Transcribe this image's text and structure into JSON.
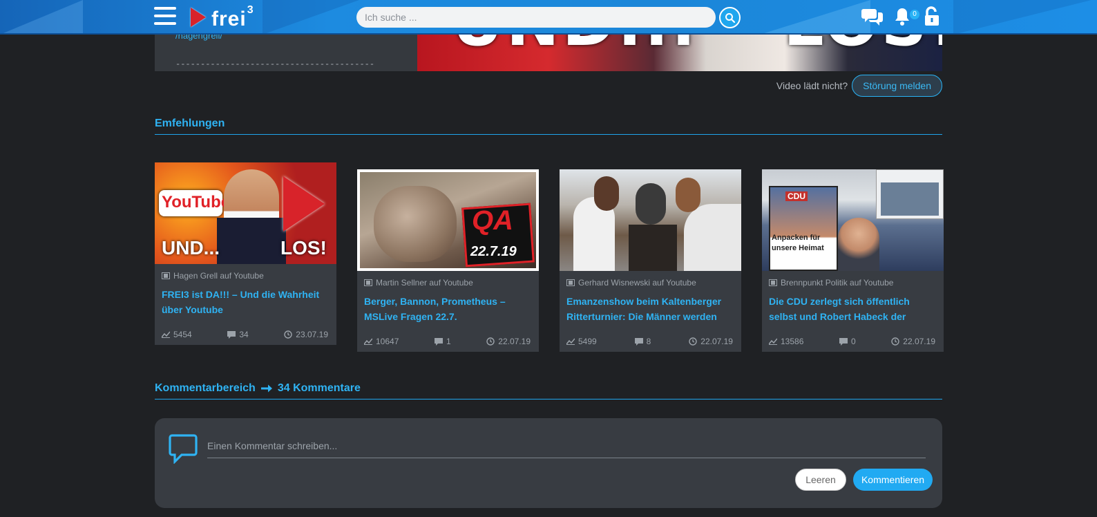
{
  "header": {
    "logo_text": "frei",
    "logo_sup": "3",
    "search_placeholder": "Ich suche ...",
    "notification_count": "0"
  },
  "video": {
    "desc_link": "/hagengrell/",
    "desc_divider": "----------------------------------------",
    "thumb_text_left": "UND...",
    "thumb_text_right": "LOS!",
    "broken_text": "Video lädt nicht?",
    "report_label": "Störung melden"
  },
  "recommendations": {
    "title": "Emfehlungen",
    "items": [
      {
        "channel": "Hagen Grell auf Youtube",
        "title": "FREI3 ist DA!!! – Und die Wahrheit über Youtube",
        "views": "5454",
        "comments": "34",
        "date": "23.07.19",
        "thumb_text_a": "YouTube",
        "thumb_text_b": "UND...",
        "thumb_text_c": "LOS!"
      },
      {
        "channel": "Martin Sellner auf Youtube",
        "title": "Berger, Bannon, Prometheus – MSLive Fragen 22.7.",
        "views": "10647",
        "comments": "1",
        "date": "22.07.19",
        "thumb_text_a": "QA",
        "thumb_text_b": "22.7.19"
      },
      {
        "channel": "Gerhard Wisnewski auf Youtube",
        "title": "Emanzenshow beim Kaltenberger Ritterturnier: Die Männer werden",
        "views": "5499",
        "comments": "8",
        "date": "22.07.19"
      },
      {
        "channel": "Brennpunkt Politik auf Youtube",
        "title": "Die CDU zerlegt sich öffentlich selbst und Robert Habeck der \"Überflieger\"",
        "views": "13586",
        "comments": "0",
        "date": "22.07.19",
        "thumb_text_a": "CDU",
        "thumb_text_b": "Anpacken für unsere Heimat"
      }
    ]
  },
  "comments": {
    "title_prefix": "Kommentarbereich",
    "title_count": "34 Kommentare",
    "input_placeholder": "Einen Kommentar schreiben...",
    "clear_label": "Leeren",
    "submit_label": "Kommentieren"
  },
  "colors": {
    "accent": "#2fb3f3",
    "background": "#1f2124",
    "card": "#383c42"
  }
}
